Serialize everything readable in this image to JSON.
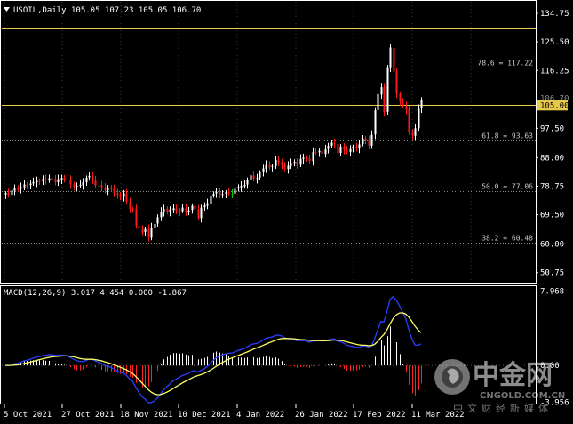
{
  "colors": {
    "background": "#000000",
    "frame": "#ffffff",
    "grid": "#3a3a3a",
    "bull": "#ffffff",
    "bear": "#ff1a1a",
    "doji": "#00cc00",
    "hline": "#e6c84a",
    "macd_line": "#2a3dff",
    "signal_line": "#ffff66",
    "hist_pos": "#ffffff",
    "hist_neg": "#ff2222"
  },
  "header": {
    "symbol_label": "USOIL,Daily",
    "ohlc_text": "105.05 107.23 105.05 106.70",
    "macd_label": "MACD(12,26,9) 3.017 4.454 0.000 -1.867"
  },
  "watermark": {
    "brand": "中金网",
    "domain": "CNGOLD.COM.CN",
    "tagline": "中文财经新媒体"
  },
  "chart_data": [
    {
      "type": "candlestick",
      "title": "USOIL,Daily",
      "ylim": [
        47.5,
        138.5
      ],
      "y_ticks": [
        "134.75",
        "125.50",
        "116.25",
        "106.70",
        "105.00",
        "97.50",
        "88.00",
        "78.75",
        "69.50",
        "60.00",
        "50.75"
      ],
      "x_ticks": [
        "5 Oct 2021",
        "27 Oct 2021",
        "18 Nov 2021",
        "10 Dec 2021",
        "4 Jan 2022",
        "26 Jan 2022",
        "17 Feb 2022",
        "11 Mar 2022"
      ],
      "horizontal_levels": [
        {
          "value": 130.0,
          "axis_label": "130.00",
          "kind": "line"
        },
        {
          "value": 105.0,
          "axis_label": "105.00",
          "kind": "line"
        },
        {
          "value": 117.22,
          "annotation": "78.6 = 117.22",
          "kind": "fib"
        },
        {
          "value": 93.63,
          "annotation": "61.8 = 93.63",
          "kind": "fib"
        },
        {
          "value": 77.06,
          "annotation": "50.0 = 77.06",
          "kind": "fib"
        },
        {
          "value": 60.48,
          "annotation": "38.2 = 60.48",
          "kind": "fib"
        }
      ],
      "close": [
        76.5,
        76.0,
        77.4,
        78.2,
        77.8,
        78.5,
        79.3,
        79.0,
        79.6,
        80.1,
        80.5,
        80.2,
        81.1,
        80.7,
        81.3,
        80.9,
        80.1,
        81.0,
        81.4,
        80.6,
        80.9,
        79.4,
        78.5,
        78.9,
        79.2,
        80.0,
        81.5,
        82.1,
        81.0,
        78.9,
        79.0,
        78.4,
        77.5,
        78.1,
        77.8,
        76.6,
        76.0,
        75.2,
        76.4,
        73.8,
        71.4,
        71.4,
        65.9,
        65.0,
        63.8,
        64.9,
        62.2,
        65.4,
        66.5,
        68.7,
        70.5,
        71.4,
        70.4,
        71.1,
        71.6,
        70.9,
        70.6,
        71.8,
        70.5,
        70.9,
        72.4,
        71.4,
        68.4,
        71.8,
        72.5,
        73.2,
        75.6,
        76.3,
        76.9,
        76.0,
        76.2,
        76.8,
        76.4,
        76.3,
        77.9,
        78.5,
        78.9,
        79.2,
        80.7,
        82.3,
        81.2,
        81.4,
        83.2,
        84.5,
        85.6,
        84.9,
        85.3,
        87.3,
        86.5,
        85.6,
        84.4,
        85.4,
        86.3,
        86.6,
        85.8,
        87.6,
        88.0,
        87.7,
        87.0,
        89.8,
        89.6,
        90.2,
        89.3,
        90.7,
        91.8,
        92.9,
        92.5,
        89.4,
        91.6,
        90.5,
        89.8,
        90.8,
        91.6,
        91.1,
        92.3,
        94.2,
        93.8,
        91.9,
        95.4,
        103.4,
        108.6,
        110.8,
        102.7,
        117.3,
        123.7,
        115.9,
        108.7,
        106.1,
        104.8,
        103.6,
        96.4,
        95.2,
        97.5,
        103.8,
        106.7
      ],
      "macd": {
        "label": "MACD(12,26,9)",
        "values": [
          3.017,
          4.454,
          0.0,
          -1.867
        ],
        "ylim": [
          -4.0,
          8.4
        ],
        "y_ticks": [
          "7.968",
          "0.00",
          "-3.956"
        ]
      }
    }
  ]
}
